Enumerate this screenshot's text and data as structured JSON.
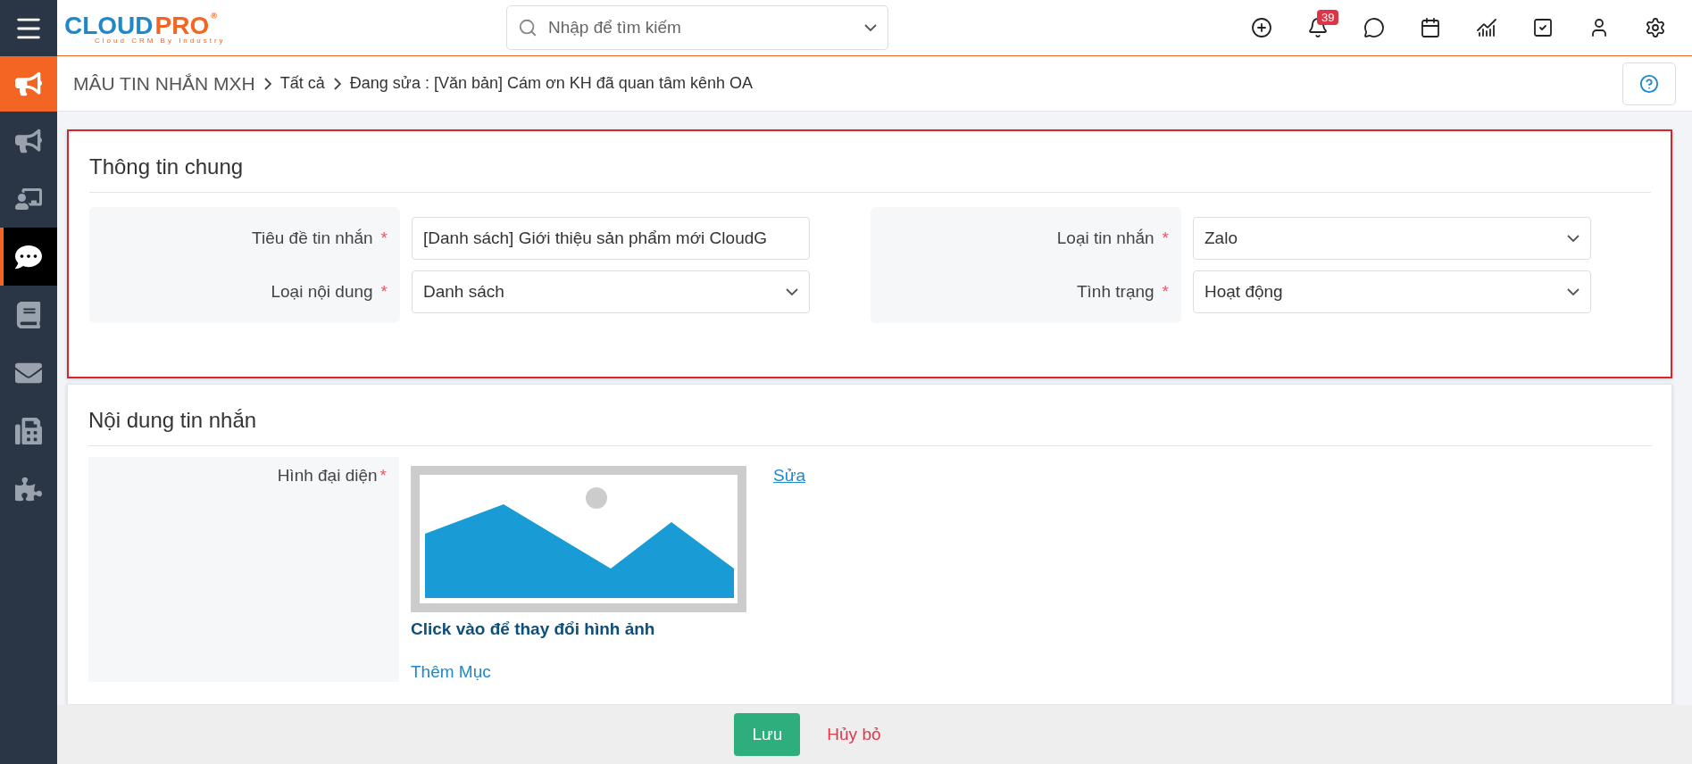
{
  "logo": {
    "brand_main": "CLOUD",
    "brand_accent": "PRO",
    "registered": "®",
    "tagline": "Cloud CRM By Industry"
  },
  "search": {
    "placeholder": "Nhập để tìm kiếm"
  },
  "header_icons": [
    {
      "kind": "add"
    },
    {
      "kind": "bell",
      "badge": "39"
    },
    {
      "kind": "chat"
    },
    {
      "kind": "calendar"
    },
    {
      "kind": "report"
    },
    {
      "kind": "task"
    },
    {
      "kind": "user"
    },
    {
      "kind": "settings"
    }
  ],
  "sidebar": {
    "items": [
      {
        "kind": "campaign",
        "selected": false
      },
      {
        "kind": "meeting",
        "selected": false
      },
      {
        "kind": "message",
        "selected": true
      },
      {
        "kind": "book",
        "selected": false
      },
      {
        "kind": "mail",
        "selected": false
      },
      {
        "kind": "fax",
        "selected": false
      },
      {
        "kind": "plugin",
        "selected": false
      }
    ]
  },
  "breadcrumb": {
    "module": "MÂU TIN NHẮN MXH",
    "items": [
      "Tất cả",
      "Đang sửa : [Văn bản] Cám ơn KH đã quan tâm kênh OA"
    ]
  },
  "sections": [
    {
      "title": "Thông tin chung",
      "highlighted": true,
      "groups": [
        {
          "fields": [
            {
              "label": "Tiêu đề tin nhắn",
              "required": true,
              "kind": "text",
              "value": "[Danh sách] Giới thiệu sản phẩm mới CloudG"
            },
            {
              "label": "Loại nội dung",
              "required": true,
              "kind": "select",
              "value": "Danh sách"
            }
          ]
        },
        {
          "fields": [
            {
              "label": "Loại tin nhắn",
              "required": true,
              "kind": "select",
              "value": "Zalo"
            },
            {
              "label": "Tình trạng",
              "required": true,
              "kind": "select",
              "value": "Hoạt động"
            }
          ]
        }
      ]
    },
    {
      "title": "Nội dung tin nhắn",
      "highlighted": false,
      "image_field": {
        "label": "Hình đại diện",
        "required": true,
        "edit_link": "Sửa",
        "caption": "Click vào để thay đổi hình ảnh"
      },
      "add_link": "Thêm Mục"
    }
  ],
  "required_mark": "*",
  "footer": {
    "save": "Lưu",
    "cancel": "Hủy bỏ"
  }
}
